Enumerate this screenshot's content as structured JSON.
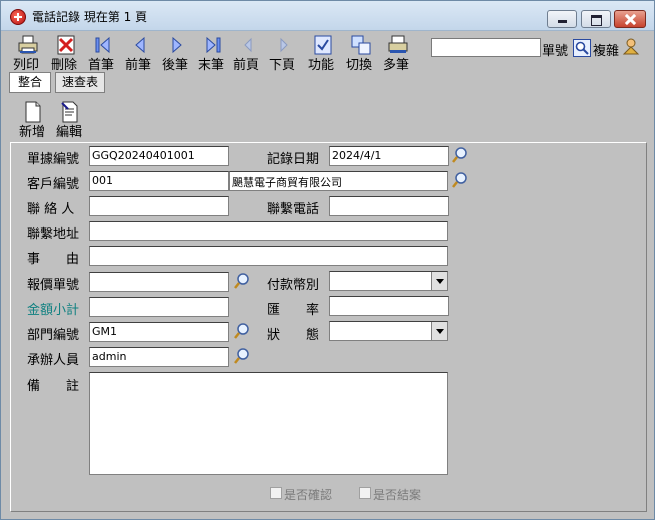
{
  "window": {
    "title": "電話記錄 現在第 1 頁"
  },
  "toolbar": {
    "items": [
      {
        "label": "列印",
        "icon": "printer-icon"
      },
      {
        "label": "刪除",
        "icon": "delete-icon"
      },
      {
        "label": "首筆",
        "icon": "first-record-icon"
      },
      {
        "label": "前筆",
        "icon": "prev-record-icon"
      },
      {
        "label": "後筆",
        "icon": "next-record-icon"
      },
      {
        "label": "末筆",
        "icon": "last-record-icon"
      },
      {
        "label": "前頁",
        "icon": "prev-page-icon"
      },
      {
        "label": "下頁",
        "icon": "next-page-icon"
      },
      {
        "label": "功能",
        "icon": "function-icon"
      },
      {
        "label": "切換",
        "icon": "switch-icon"
      },
      {
        "label": "多筆",
        "icon": "multi-record-icon"
      }
    ],
    "search_value": "",
    "doc_no_label": "單號",
    "copy_label": "複雜"
  },
  "tabs": [
    {
      "label": "整合",
      "active": true
    },
    {
      "label": "速查表",
      "active": false
    }
  ],
  "actions": {
    "new_label": "新增",
    "edit_label": "編輯"
  },
  "form": {
    "doc_no": {
      "label": "單據編號",
      "value": "GGQ20240401001"
    },
    "record_date": {
      "label": "記錄日期",
      "value": "2024/4/1"
    },
    "customer_no": {
      "label": "客戶編號",
      "value": "001",
      "name_value": "颶慧電子商貿有限公司"
    },
    "contact": {
      "label": "聯 絡 人",
      "value": ""
    },
    "contact_phone": {
      "label": "聯繫電話",
      "value": ""
    },
    "contact_address": {
      "label": "聯繫地址",
      "value": ""
    },
    "subject": {
      "label": "事　　由",
      "value": ""
    },
    "quote_no": {
      "label": "報價單號",
      "value": ""
    },
    "payment_currency": {
      "label": "付款幣別",
      "value": ""
    },
    "amount_subtotal": {
      "label": "金額小計",
      "value": ""
    },
    "exchange_rate": {
      "label": "匯　　率",
      "value": ""
    },
    "department_no": {
      "label": "部門編號",
      "value": "GM1"
    },
    "status": {
      "label": "狀　　態",
      "value": ""
    },
    "handler": {
      "label": "承辦人員",
      "value": "admin"
    },
    "remarks": {
      "label": "備　　註",
      "value": ""
    }
  },
  "checkboxes": {
    "confirmed": {
      "label": "是否確認",
      "checked": false
    },
    "closed": {
      "label": "是否結案",
      "checked": false
    }
  },
  "colors": {
    "teal_label": "#0f8080",
    "panel_bg": "#c0c0c0"
  }
}
